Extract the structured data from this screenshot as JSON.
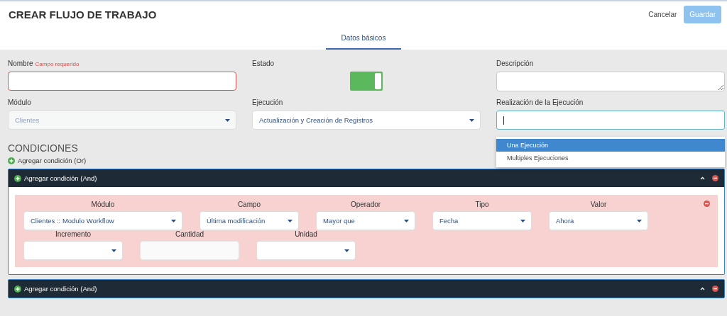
{
  "header": {
    "title": "CREAR FLUJO DE TRABAJO",
    "cancel": "Cancelar",
    "save": {
      "label": "Guardar",
      "disabled": true
    }
  },
  "tabs": [
    {
      "label": "Datos básicos",
      "selected": true
    }
  ],
  "fields": [
    {
      "kind": "text",
      "label": "Nombre",
      "error": "Campo requerido"
    },
    {
      "kind": "toggle",
      "label": "Estado",
      "on": true
    },
    {
      "kind": "textarea",
      "label": "Descripción"
    },
    {
      "kind": "select",
      "label": "Módulo",
      "value": "Clientes",
      "disabled": true
    },
    {
      "kind": "select",
      "label": "Ejecución",
      "value": "Actualización y Creación de Registros",
      "disabled": false
    },
    {
      "kind": "combo",
      "label": "Realización de la Ejecución",
      "options": [
        {
          "label": "Una Ejecución",
          "selected": true
        },
        {
          "label": "Multiples Ejecuciones",
          "selected": false
        }
      ]
    }
  ],
  "conditions": {
    "title": "CONDICIONES",
    "add_or": "Agregar condición (Or)",
    "groups": [
      {
        "label": "Agregar condición (And)",
        "rows": [
          [
            {
              "kind": "select",
              "label": "Módulo",
              "value": "Clientes :: Modulo Workflow"
            },
            {
              "kind": "select",
              "label": "Campo",
              "value": "Última modificación"
            },
            {
              "kind": "select",
              "label": "Operador",
              "value": "Mayor que"
            },
            {
              "kind": "select",
              "label": "Tipo",
              "value": "Fecha"
            },
            {
              "kind": "select",
              "label": "Valor",
              "value": "Ahora"
            }
          ],
          [
            {
              "kind": "select",
              "label": "Incremento"
            },
            {
              "kind": "input",
              "label": "Cantidad"
            },
            {
              "kind": "select",
              "label": "Unidad"
            }
          ]
        ]
      },
      {
        "label": "Agregar condición (And)"
      }
    ]
  }
}
